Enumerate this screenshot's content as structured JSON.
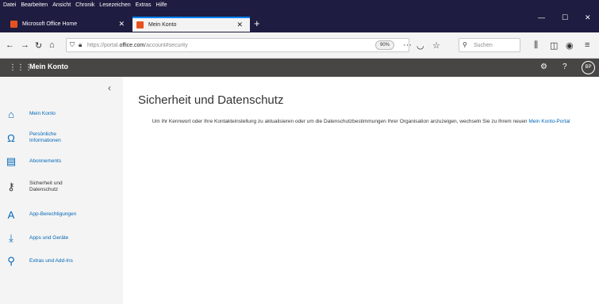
{
  "menubar": {
    "items": [
      "Datei",
      "Bearbeiten",
      "Ansicht",
      "Chronik",
      "Lesezeichen",
      "Extras",
      "Hilfe"
    ]
  },
  "tabs": [
    {
      "label": "Microsoft Office Home"
    },
    {
      "label": "Mein Konto"
    }
  ],
  "navbar": {
    "url_prefix": "https://portal.",
    "url_host": "office.com",
    "url_path": "/account#security",
    "zoom": "90%",
    "search_placeholder": "Suchen"
  },
  "appbar": {
    "title": "Mein Konto",
    "avatar_initials": "BP"
  },
  "sidebar": {
    "items": [
      {
        "label": "Mein Konto",
        "icon": "home-icon",
        "glyph": "⌂"
      },
      {
        "label": "Persönliche Informationen",
        "icon": "person-icon",
        "glyph": "Ω"
      },
      {
        "label": "Abonnements",
        "icon": "card-icon",
        "glyph": "▤"
      },
      {
        "label": "Sicherheit und Datenschutz",
        "icon": "key-icon",
        "glyph": "⚷"
      },
      {
        "label": "App-Berechtigungen",
        "icon": "lock-icon",
        "glyph": "A"
      },
      {
        "label": "Apps und Geräte",
        "icon": "download-icon",
        "glyph": "⤓"
      },
      {
        "label": "Extras und Add-Ins",
        "icon": "wrench-icon",
        "glyph": "⚲"
      }
    ]
  },
  "main": {
    "title": "Sicherheit und Datenschutz",
    "info_text": "Um Ihr Kennwort oder Ihre Kontakteinstellung zu aktualisieren oder um die Datenschutzbestimmungen Ihrer Organisation anzuzeigen, wechseln Sie zu Ihrem neuen",
    "info_link": "Mein Konto-Portal"
  },
  "colors": {
    "accent": "#0067b8",
    "appbar": "#484644",
    "titlebar": "#1e1c40"
  }
}
